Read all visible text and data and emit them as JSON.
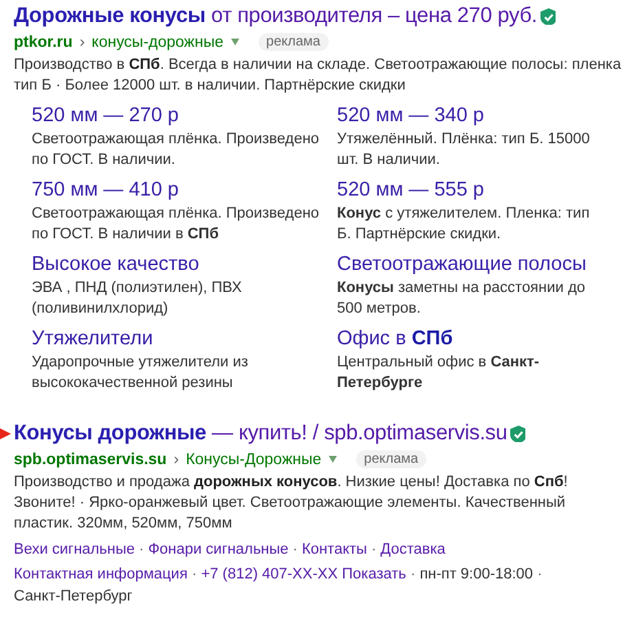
{
  "ads": [
    {
      "marked": false,
      "title": "**Дорожные конусы** от производителя – цена 270 руб.",
      "verified": true,
      "domain": "ptkor.ru",
      "separator": "›",
      "path": "конусы-дорожные",
      "label": "реклама",
      "text": "Производство в **СПб**. Всегда в наличии на складе. Светоотражающие полосы: пленка тип Б · Более 12000 шт. в наличии. Партнёрские скидки",
      "sitelinks": [
        {
          "title": "520 мм — 270 р",
          "text": "Светоотражающая плёнка. Произведено по ГОСТ. В наличии."
        },
        {
          "title": "520 мм — 340 р",
          "text": "Утяжелённый. Плёнка: тип Б. 15000 шт. В наличии."
        },
        {
          "title": "750 мм — 410 р",
          "text": "Светоотражающая плёнка. Произведено по ГОСТ. В наличии в **СПб**"
        },
        {
          "title": "520 мм — 555 р",
          "text": "**Конус** с утяжелителем. Пленка: тип Б. Партнёрские скидки."
        },
        {
          "title": "Высокое качество",
          "text": "ЭВА , ПНД (полиэтилен), ПВХ (поливинилхлорид)"
        },
        {
          "title": "Светоотражающие полосы",
          "text": "**Конусы** заметны на расстоянии до 500 метров."
        },
        {
          "title": "Утяжелители",
          "text": "Ударопрочные утяжелители из высококачественной резины"
        },
        {
          "title": "Офис в **СПб**",
          "text": "Центральный офис в **Санкт-Петербурге**"
        }
      ]
    },
    {
      "marked": true,
      "title": "**Конусы дорожные** — купить! / spb.optimaservis.su",
      "verified": true,
      "domain": "spb.optimaservis.su",
      "separator": "›",
      "path": "Конусы-Дорожные",
      "label": "реклама",
      "text": "Производство и продажа **дорожных конусов**. Низкие цены! Доставка по **Спб**! Звоните! · Ярко-оранжевый цвет. Светоотражающие элементы. Качественный пластик. 320мм, 520мм, 750мм",
      "link_separator": "·",
      "quick_links": [
        "Вехи сигнальные",
        "Фонари сигнальные",
        "Контакты",
        "Доставка"
      ],
      "contacts": [
        {
          "kind": "link",
          "text": "Контактная информация"
        },
        {
          "kind": "link",
          "text": "+7 (812) 407-XX-XX Показать"
        },
        {
          "kind": "text",
          "text": "пн-пт 9:00-18:00"
        },
        {
          "kind": "text",
          "text": "Санкт-Петербург"
        }
      ]
    }
  ]
}
